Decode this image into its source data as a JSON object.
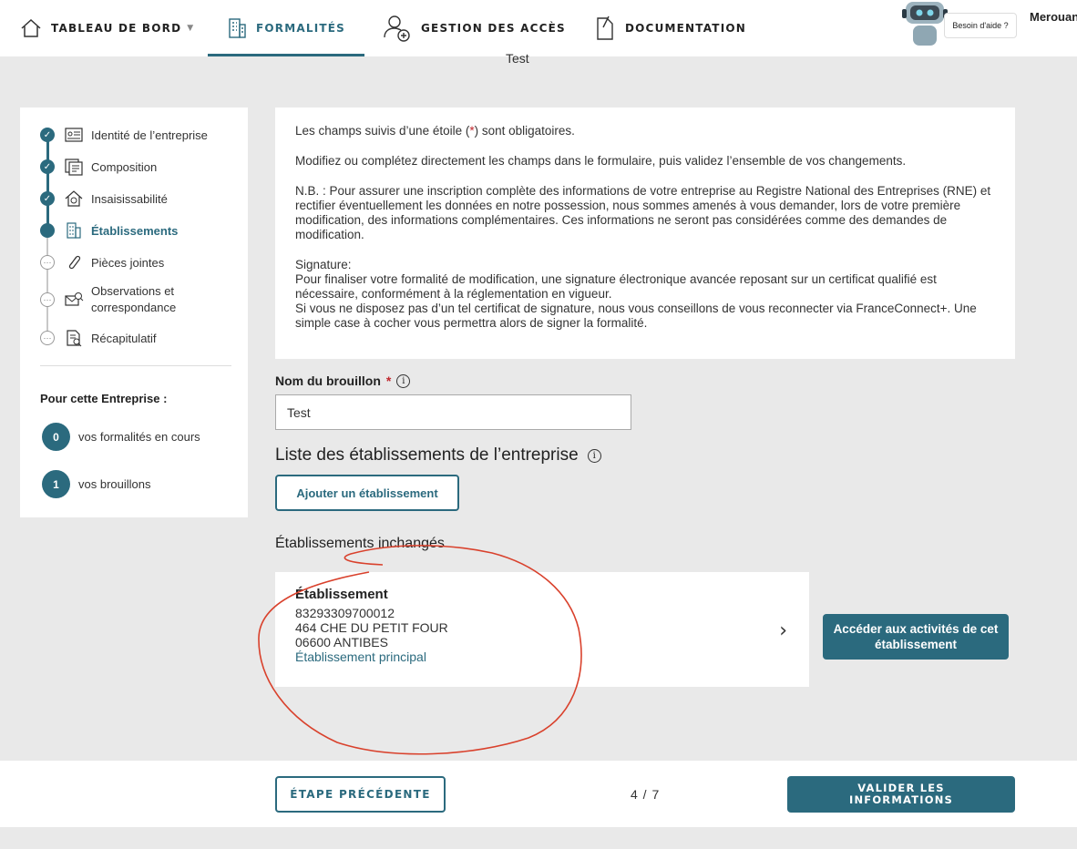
{
  "nav": {
    "dashboard": "TABLEAU DE BORD",
    "formalites": "FORMALITÉS",
    "acces": "GESTION DES ACCÈS",
    "documentation": "DOCUMENTATION",
    "help": "Besoin d'aide ?",
    "user": "Merouan"
  },
  "crumb": "Test",
  "colors": {
    "accent": "#2b6a7e",
    "required": "#c0282e",
    "annotation": "#d9412c"
  },
  "steps": [
    {
      "label": "Identité de l’entreprise",
      "state": "done",
      "icon": "id-card-icon"
    },
    {
      "label": "Composition",
      "state": "done",
      "icon": "composition-icon"
    },
    {
      "label": "Insaisissabilité",
      "state": "done",
      "icon": "house-icon"
    },
    {
      "label": "Établissements",
      "state": "current",
      "icon": "building-icon"
    },
    {
      "label": "Pièces jointes",
      "state": "todo",
      "icon": "paperclip-icon"
    },
    {
      "label": "Observations et correspondance",
      "state": "todo",
      "icon": "mail-search-icon"
    },
    {
      "label": "Récapitulatif",
      "state": "todo",
      "icon": "document-search-icon"
    }
  ],
  "sidebar": {
    "title": "Pour cette Entreprise :",
    "formalites_count": "0",
    "formalites_label": "vos formalités en cours",
    "drafts_count": "1",
    "drafts_label": "vos brouillons"
  },
  "info": {
    "required_prefix": "Les champs suivis d’une étoile (",
    "required_star": "*",
    "required_suffix": ") sont obligatoires.",
    "p2": "Modifiez ou complétez directement les champs dans le formulaire, puis validez l’ensemble de vos changements.",
    "p3": "N.B. : Pour assurer une inscription complète des informations de votre entreprise au Registre National des Entreprises (RNE) et rectifier éventuellement les données en notre possession, nous sommes amenés à vous demander, lors de votre première modification, des informations complémentaires. Ces informations ne seront pas considérées comme des demandes de modification.",
    "sig_title": "Signature:",
    "sig_1": "Pour finaliser votre formalité de modification, une signature électronique avancée reposant sur un certificat qualifié est nécessaire, conformément à la réglementation en vigueur.",
    "sig_2": "Si vous ne disposez pas d’un tel certificat de signature, nous vous conseillons de vous reconnecter via FranceConnect+. Une simple case à cocher vous permettra alors de signer la formalité."
  },
  "form": {
    "draft_label": "Nom du brouillon",
    "draft_required": "*",
    "draft_value": "Test",
    "list_title": "Liste des établissements de l’entreprise",
    "add_button": "Ajouter un établissement",
    "unchanged_title": "Établissements inchangés"
  },
  "establishment": {
    "title": "Établissement",
    "siret": "83293309700012",
    "address": "464 CHE DU PETIT FOUR",
    "city": "06600 ANTIBES",
    "type": "Établissement principal",
    "activities_button": "Accéder aux activités de cet établissement"
  },
  "footer": {
    "prev": "ÉTAPE PRÉCÉDENTE",
    "pager": "4 / 7",
    "validate": "VALIDER LES INFORMATIONS"
  }
}
